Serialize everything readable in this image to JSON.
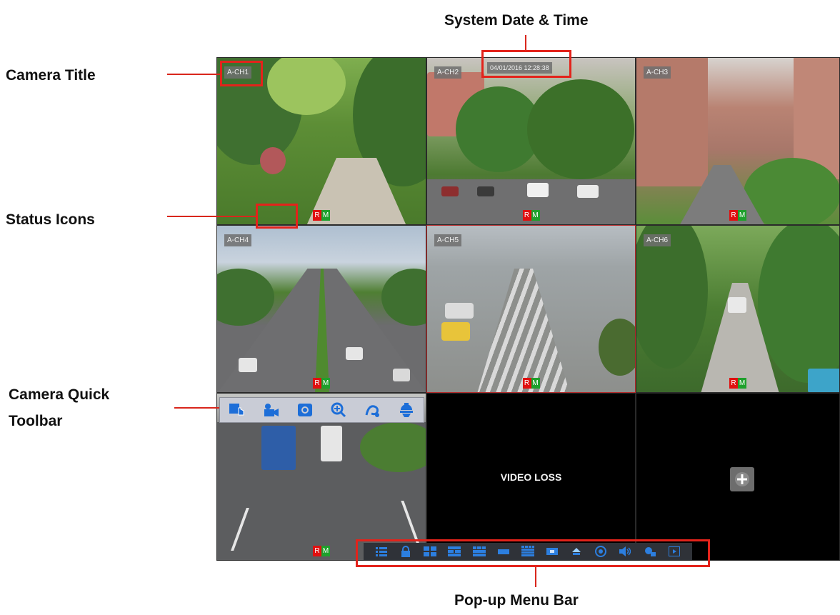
{
  "callouts": {
    "system_date_time": "System Date & Time",
    "camera_title": "Camera Title",
    "status_icons": "Status Icons",
    "camera_quick_toolbar_line1": "Camera Quick",
    "camera_quick_toolbar_line2": "Toolbar",
    "popup_menu_bar": "Pop-up Menu Bar"
  },
  "osd": {
    "datetime": "04/01/2016 12:28:38"
  },
  "channels": [
    {
      "label": "A-CH1",
      "status_r": "R",
      "status_m": "M"
    },
    {
      "label": "A-CH2",
      "status_r": "R",
      "status_m": "M"
    },
    {
      "label": "A-CH3",
      "status_r": "R",
      "status_m": "M"
    },
    {
      "label": "A-CH4",
      "status_r": "R",
      "status_m": "M"
    },
    {
      "label": "A-CH5",
      "status_r": "R",
      "status_m": "M"
    },
    {
      "label": "A-CH6",
      "status_r": "R",
      "status_m": "M"
    },
    {
      "label": "",
      "status_r": "R",
      "status_m": "M"
    }
  ],
  "video_loss_text": "VIDEO LOSS",
  "quick_toolbar_icons": [
    "touch-icon",
    "record-icon",
    "snapshot-icon",
    "zoom-icon",
    "color-icon",
    "ptz-icon"
  ],
  "menu_bar_icons": [
    "menu-icon",
    "lock-icon",
    "layout-1-icon",
    "layout-4-icon",
    "layout-9-icon",
    "layout-wide-icon",
    "layout-16-icon",
    "screen-icon",
    "up-icon",
    "record-icon",
    "audio-icon",
    "network-icon",
    "playback-icon"
  ],
  "colors": {
    "callout_red": "#e3231b",
    "record_red": "#e01010",
    "motion_green": "#1ea02c",
    "icon_blue": "#2c7fe0"
  }
}
